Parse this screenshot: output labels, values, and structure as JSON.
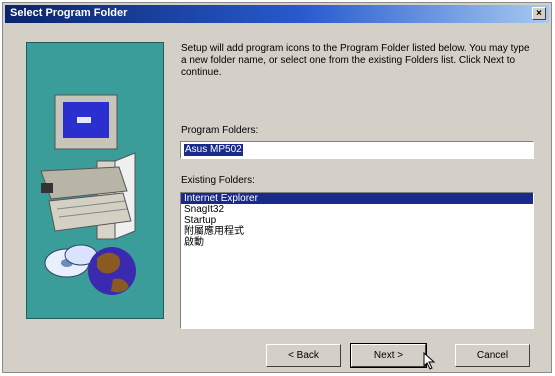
{
  "window": {
    "title": "Select Program Folder",
    "close_glyph": "×"
  },
  "instructions": "Setup will add program icons to the Program Folder listed below. You may type a new folder name, or select one from the existing Folders list. Click Next to continue.",
  "program_folder": {
    "label": "Program Folders:",
    "value": "Asus MP502"
  },
  "existing_folders": {
    "label": "Existing Folders:",
    "items": [
      "Internet Explorer",
      "SnagIt32",
      "Startup",
      "附屬應用程式",
      "啟動"
    ],
    "selected_index": 0
  },
  "buttons": {
    "back": "< Back",
    "next": "Next >",
    "cancel": "Cancel"
  },
  "icons": [
    "close-icon",
    "computer-icon",
    "globe-icon",
    "disc-icon",
    "mouse-cursor-icon"
  ],
  "colors": {
    "titlebar": "#0a246a",
    "banner": "#3a9d9a",
    "selection": "#1a2a8a"
  }
}
